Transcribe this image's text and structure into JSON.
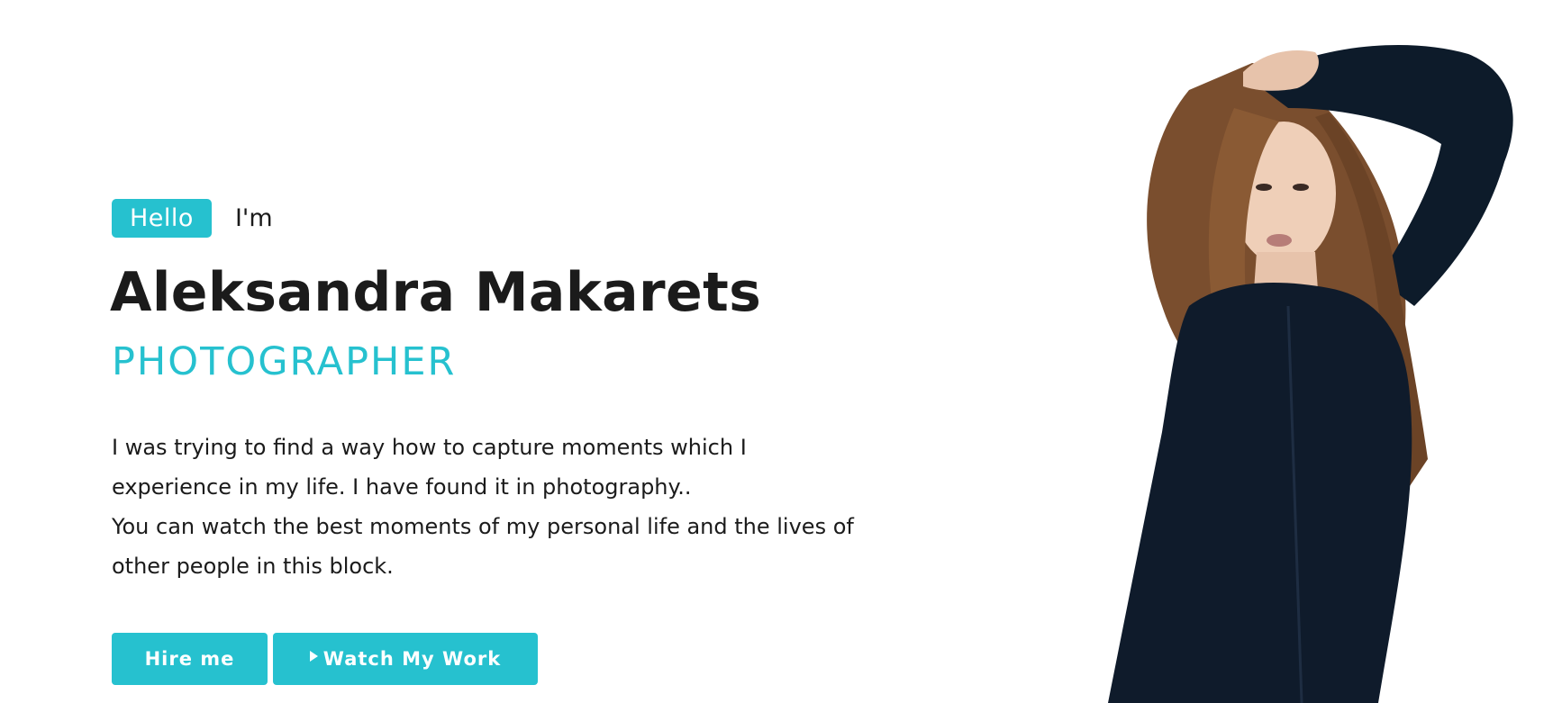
{
  "colors": {
    "accent": "#26c1cf",
    "text": "#1b1b1b",
    "background": "#ffffff"
  },
  "hero": {
    "hello_badge": "Hello",
    "im_text": "I'm",
    "name": "Aleksandra Makarets",
    "role": "PHOTOGRAPHER",
    "bio": [
      "I was trying to find a way how to capture moments which I experience in my life. I have found it in photography..",
      "You can watch the best moments of my personal life and the lives of other people in this block."
    ],
    "buttons": {
      "hire_label": "Hire me",
      "watch_label": "Watch My Work",
      "watch_icon": "play-icon"
    }
  }
}
